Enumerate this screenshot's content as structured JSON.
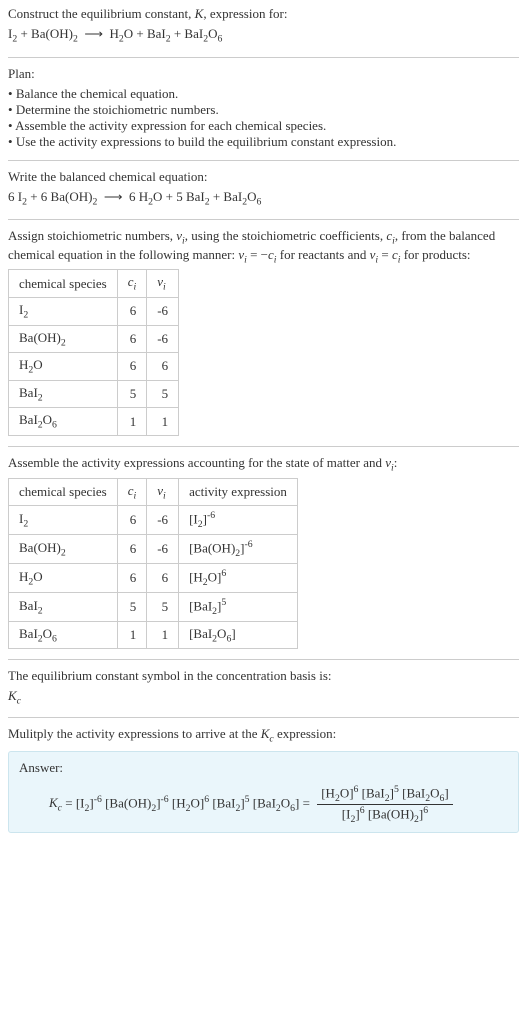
{
  "prompt": {
    "line1": "Construct the equilibrium constant, K, expression for:",
    "equation": "I₂ + Ba(OH)₂  ⟶  H₂O + BaI₂ + BaI₂O₆"
  },
  "plan": {
    "heading": "Plan:",
    "bullets": [
      "Balance the chemical equation.",
      "Determine the stoichiometric numbers.",
      "Assemble the activity expression for each chemical species.",
      "Use the activity expressions to build the equilibrium constant expression."
    ]
  },
  "balanced": {
    "heading": "Write the balanced chemical equation:",
    "equation": "6 I₂ + 6 Ba(OH)₂  ⟶  6 H₂O + 5 BaI₂ + BaI₂O₆"
  },
  "stoich": {
    "heading": "Assign stoichiometric numbers, νᵢ, using the stoichiometric coefficients, cᵢ, from the balanced chemical equation in the following manner: νᵢ = −cᵢ for reactants and νᵢ = cᵢ for products:",
    "table": {
      "headers": [
        "chemical species",
        "cᵢ",
        "νᵢ"
      ],
      "rows": [
        {
          "species": "I₂",
          "c": "6",
          "v": "-6"
        },
        {
          "species": "Ba(OH)₂",
          "c": "6",
          "v": "-6"
        },
        {
          "species": "H₂O",
          "c": "6",
          "v": "6"
        },
        {
          "species": "BaI₂",
          "c": "5",
          "v": "5"
        },
        {
          "species": "BaI₂O₆",
          "c": "1",
          "v": "1"
        }
      ]
    }
  },
  "activity": {
    "heading": "Assemble the activity expressions accounting for the state of matter and νᵢ:",
    "table": {
      "headers": [
        "chemical species",
        "cᵢ",
        "νᵢ",
        "activity expression"
      ],
      "rows": [
        {
          "species": "I₂",
          "c": "6",
          "v": "-6",
          "expr": "[I₂]⁻⁶"
        },
        {
          "species": "Ba(OH)₂",
          "c": "6",
          "v": "-6",
          "expr": "[Ba(OH)₂]⁻⁶"
        },
        {
          "species": "H₂O",
          "c": "6",
          "v": "6",
          "expr": "[H₂O]⁶"
        },
        {
          "species": "BaI₂",
          "c": "5",
          "v": "5",
          "expr": "[BaI₂]⁵"
        },
        {
          "species": "BaI₂O₆",
          "c": "1",
          "v": "1",
          "expr": "[BaI₂O₆]"
        }
      ]
    }
  },
  "symbol": {
    "heading": "The equilibrium constant symbol in the concentration basis is:",
    "value": "K_c"
  },
  "final": {
    "heading": "Mulitply the activity expressions to arrive at the K_c expression:",
    "answer_label": "Answer:",
    "lhs": "K_c = [I₂]⁻⁶ [Ba(OH)₂]⁻⁶ [H₂O]⁶ [BaI₂]⁵ [BaI₂O₆] = ",
    "numerator": "[H₂O]⁶ [BaI₂]⁵ [BaI₂O₆]",
    "denominator": "[I₂]⁶ [Ba(OH)₂]⁶"
  }
}
